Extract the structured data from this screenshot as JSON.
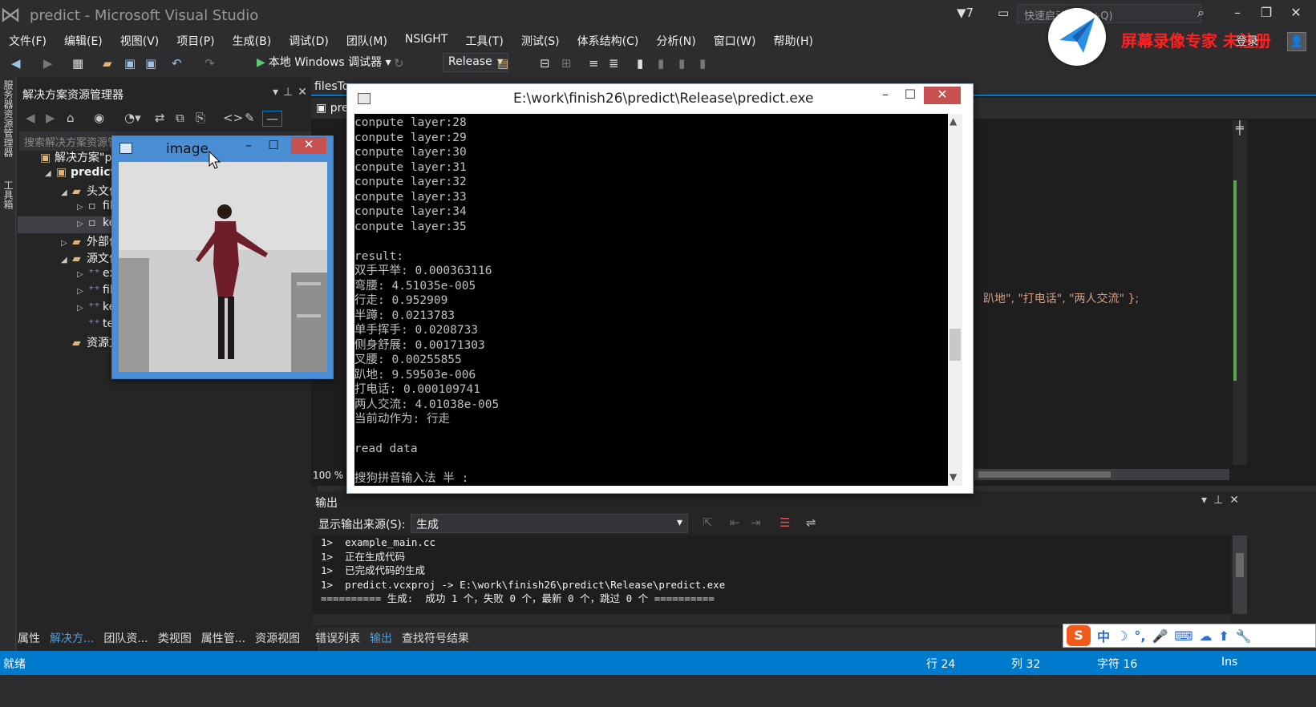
{
  "app": {
    "title": "predict - Microsoft Visual Studio",
    "notifications_count": "7",
    "quick_launch_placeholder": "快速启动 (Ctrl+Q)",
    "login_label": "登录",
    "recorder_brand": "屏幕录像专家 未注册"
  },
  "menu": [
    "文件(F)",
    "编辑(E)",
    "视图(V)",
    "项目(P)",
    "生成(B)",
    "调试(D)",
    "团队(M)",
    "NSIGHT",
    "工具(T)",
    "测试(S)",
    "体系结构(C)",
    "分析(N)",
    "窗口(W)",
    "帮助(H)"
  ],
  "toolbar": {
    "run_label": "本地 Windows 调试器",
    "configuration": "Release"
  },
  "left_strip_tabs": [
    "服务器资源管理器",
    "工具箱"
  ],
  "solution_explorer": {
    "title": "解决方案资源管理器",
    "search_placeholder": "搜索解决方案资源管理器(Ctrl+;)",
    "tree": [
      {
        "label": "解决方案\"pr",
        "indent": 0,
        "arrow": "",
        "icon": "solution"
      },
      {
        "label": "predict",
        "indent": 1,
        "arrow": "◢",
        "icon": "project",
        "bold": true
      },
      {
        "label": "头文件",
        "indent": 2,
        "arrow": "◢",
        "icon": "folder"
      },
      {
        "label": "file",
        "indent": 3,
        "arrow": "▷",
        "icon": "file"
      },
      {
        "label": "ke",
        "indent": 3,
        "arrow": "▷",
        "icon": "file",
        "selected": true
      },
      {
        "label": "外部依",
        "indent": 2,
        "arrow": "▷",
        "icon": "folder"
      },
      {
        "label": "源文件",
        "indent": 2,
        "arrow": "◢",
        "icon": "folder"
      },
      {
        "label": "ex",
        "indent": 3,
        "arrow": "▷",
        "icon": "cpp"
      },
      {
        "label": "file",
        "indent": 3,
        "arrow": "▷",
        "icon": "cpp"
      },
      {
        "label": "ke",
        "indent": 3,
        "arrow": "▷",
        "icon": "cpp"
      },
      {
        "label": "tes",
        "indent": 3,
        "arrow": "",
        "icon": "cpp"
      },
      {
        "label": "资源文",
        "indent": 2,
        "arrow": "",
        "icon": "folder"
      }
    ],
    "bottom_tabs": [
      "属性",
      "解决方...",
      "团队资...",
      "类视图",
      "属性管...",
      "资源视图"
    ],
    "active_bottom_tab": 1
  },
  "editor": {
    "doc_tab": "filesTo",
    "nav_fragment": "pre",
    "code_fragment": "趴地\", \"打电话\", \"两人交流\" };",
    "zoom": "100 %"
  },
  "output": {
    "title": "输出",
    "source_label": "显示输出来源(S):",
    "source_value": "生成",
    "lines": [
      "1>  example_main.cc",
      "1>  正在生成代码",
      "1>  已完成代码的生成",
      "1>  predict.vcxproj -> E:\\work\\finish26\\predict\\Release\\predict.exe",
      "========== 生成:  成功 1 个，失败 0 个，最新 0 个，跳过 0 个 =========="
    ],
    "bottom_tabs": [
      "错误列表",
      "输出",
      "查找符号结果"
    ],
    "active_bottom_tab": 1
  },
  "console": {
    "title": "E:\\work\\finish26\\predict\\Release\\predict.exe",
    "lines": [
      "conpute layer:28",
      "conpute layer:29",
      "conpute layer:30",
      "conpute layer:31",
      "conpute layer:32",
      "conpute layer:33",
      "conpute layer:34",
      "conpute layer:35",
      "",
      "result:",
      "双手平举: 0.000363116",
      "弯腰: 4.51035e-005",
      "行走: 0.952909",
      "半蹲: 0.0213783",
      "单手挥手: 0.0208733",
      "侧身舒展: 0.00171303",
      "叉腰: 0.00255855",
      "趴地: 9.59503e-006",
      "打电话: 0.000109741",
      "两人交流: 4.01038e-005",
      "当前动作为: 行走",
      "",
      "read data",
      "",
      "搜狗拼音输入法 半 :"
    ]
  },
  "image_window": {
    "title": "image"
  },
  "ime": {
    "logo": "S",
    "mode": "中",
    "icons": [
      "moon-icon",
      "punct-icon",
      "mic-icon",
      "keyboard-icon",
      "skin-icon",
      "upload-icon",
      "tools-icon"
    ]
  },
  "statusbar": {
    "ready": "就绪",
    "line": "行 24",
    "col": "列 32",
    "char": "字符 16",
    "mode": "Ins"
  },
  "colors": {
    "accent": "#007acc",
    "chrome": "#2d2d30",
    "console_bg": "#000000",
    "close_red": "#c75050"
  }
}
